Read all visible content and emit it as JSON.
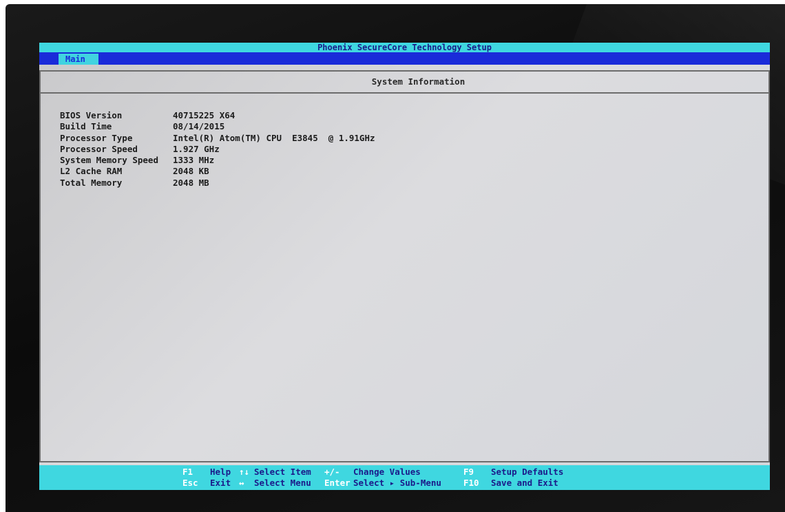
{
  "bios": {
    "title": "Phoenix SecureCore Technology Setup",
    "menu_tab": "Main",
    "section_title": "System Information",
    "info": [
      {
        "label": "BIOS Version",
        "value": "40715225 X64"
      },
      {
        "label": "Build Time",
        "value": "08/14/2015"
      },
      {
        "label": "Processor Type",
        "value": "Intel(R) Atom(TM) CPU  E3845  @ 1.91GHz"
      },
      {
        "label": "Processor Speed",
        "value": "1.927 GHz"
      },
      {
        "label": "System Memory Speed",
        "value": "1333 MHz"
      },
      {
        "label": "L2 Cache RAM",
        "value": "2048 KB"
      },
      {
        "label": "Total Memory",
        "value": "2048 MB"
      }
    ],
    "footer": {
      "row1": [
        {
          "key": "F1",
          "desc": "Help"
        },
        {
          "key": "↑↓",
          "desc": "Select Item"
        },
        {
          "key": "+/-",
          "desc": "Change Values"
        },
        {
          "key": "F9",
          "desc": "Setup Defaults"
        }
      ],
      "row2": [
        {
          "key": "Esc",
          "desc": "Exit"
        },
        {
          "key": "↔",
          "desc": "Select Menu"
        },
        {
          "key": "Enter",
          "desc": "Select ▸ Sub-Menu"
        },
        {
          "key": "F10",
          "desc": "Save and Exit"
        }
      ]
    }
  },
  "colors": {
    "title_bar": "#3fd7e0",
    "menu_bar": "#1a2bd9",
    "footer_key": "#ffffff",
    "footer_desc": "#1b1b8a",
    "screen_bg": "#d4d6db"
  }
}
